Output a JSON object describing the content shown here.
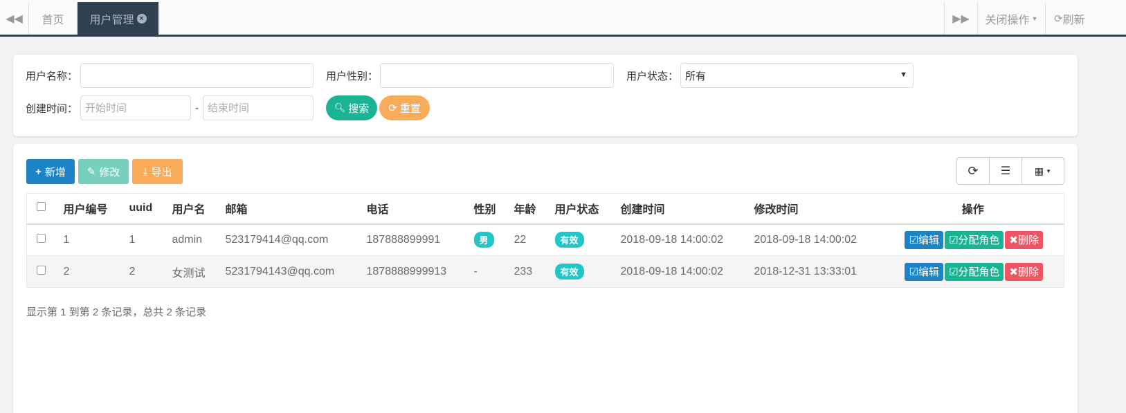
{
  "tabs": {
    "home": "首页",
    "active": "用户管理",
    "close_ops": "关闭操作",
    "refresh": "刷新"
  },
  "search": {
    "username_label": "用户名称：",
    "gender_label": "用户性别：",
    "status_label": "用户状态：",
    "status_value": "所有",
    "created_label": "创建时间：",
    "start_placeholder": "开始时间",
    "end_placeholder": "结束时间",
    "dash": "-",
    "search_btn": "搜索",
    "reset_btn": "重置"
  },
  "toolbar": {
    "add": "新增",
    "edit": "修改",
    "export": "导出"
  },
  "table": {
    "headers": [
      "用户编号",
      "uuid",
      "用户名",
      "邮箱",
      "电话",
      "性别",
      "年龄",
      "用户状态",
      "创建时间",
      "修改时间",
      "操作"
    ],
    "rows": [
      {
        "id": "1",
        "uuid": "1",
        "name": "admin",
        "email": "523179414@qq.com",
        "phone": "187888899991",
        "gender": "男",
        "age": "22",
        "status": "有效",
        "created": "2018-09-18 14:00:02",
        "modified": "2018-09-18 14:00:02"
      },
      {
        "id": "2",
        "uuid": "2",
        "name": "女测试",
        "email": "5231794143@qq.com",
        "phone": "1878888999913",
        "gender": "-",
        "age": "233",
        "status": "有效",
        "created": "2018-09-18 14:00:02",
        "modified": "2018-12-31 13:33:01"
      }
    ],
    "actions": {
      "edit": "编辑",
      "assign_role": "分配角色",
      "delete": "删除"
    }
  },
  "pager": {
    "summary": "显示第 1 到第 2 条记录，总共 2 条记录"
  },
  "colors": {
    "dark": "#2f4050",
    "blue": "#1c84c6",
    "green": "#1ab394",
    "teal": "#23c6c8",
    "orange": "#f8ac59",
    "red": "#ed5565"
  }
}
